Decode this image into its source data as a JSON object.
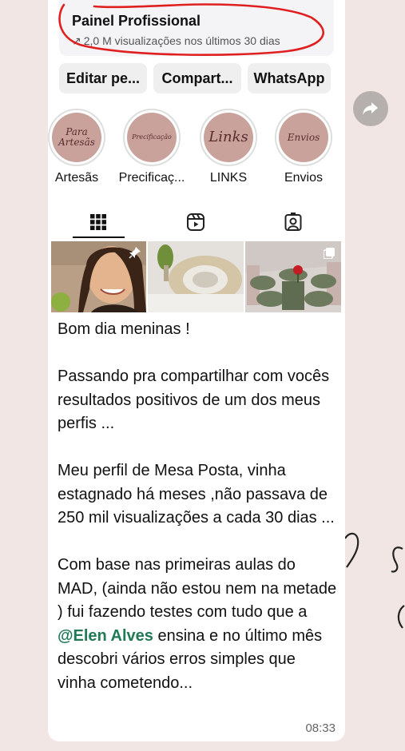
{
  "dashboard": {
    "title": "Painel Profissional",
    "arrow": "↗",
    "subtitle": "2,0 M visualizações nos últimos 30 dias",
    "circle_color": "#e02020"
  },
  "actions": [
    {
      "label": "Editar pe..."
    },
    {
      "label": "Compart..."
    },
    {
      "label": "WhatsApp"
    }
  ],
  "highlights": [
    {
      "cover_text": "Para Artesãs",
      "label": "Artesãs"
    },
    {
      "cover_text": "Precificação",
      "label": "Precificaç..."
    },
    {
      "cover_text": "Links",
      "label": "LINKS"
    },
    {
      "cover_text": "Envios",
      "label": "Envios"
    }
  ],
  "tabs": [
    {
      "icon": "grid-icon",
      "selected": true
    },
    {
      "icon": "reels-icon",
      "selected": false
    },
    {
      "icon": "tagged-icon",
      "selected": false
    }
  ],
  "grid": [
    {
      "desc": "woman-selfie",
      "badge": "pin-icon"
    },
    {
      "desc": "placemat-table",
      "badge": ""
    },
    {
      "desc": "table-setting",
      "badge": "carousel-icon"
    }
  ],
  "message": {
    "line1": "Bom dia meninas !",
    "para2": "Passando pra compartilhar com vocês resultados positivos de um dos meus perfis ...",
    "para3": "Meu perfil de Mesa Posta, vinha estagnado há meses ,não passava de 250 mil visualizações a cada 30 dias ...",
    "para4_before": "Com base nas primeiras aulas do MAD, (ainda não estou nem na metade ) fui fazendo testes com tudo que a ",
    "mention": "@Elen Alves",
    "para4_after": " ensina e no último mês descobri vários erros simples que vinha cometendo...",
    "time": "08:33"
  },
  "colors": {
    "chat_background": "#f1e6e3",
    "bubble": "#ffffff",
    "mention": "#1f7a55",
    "highlight_cover": "#c9a29c"
  }
}
